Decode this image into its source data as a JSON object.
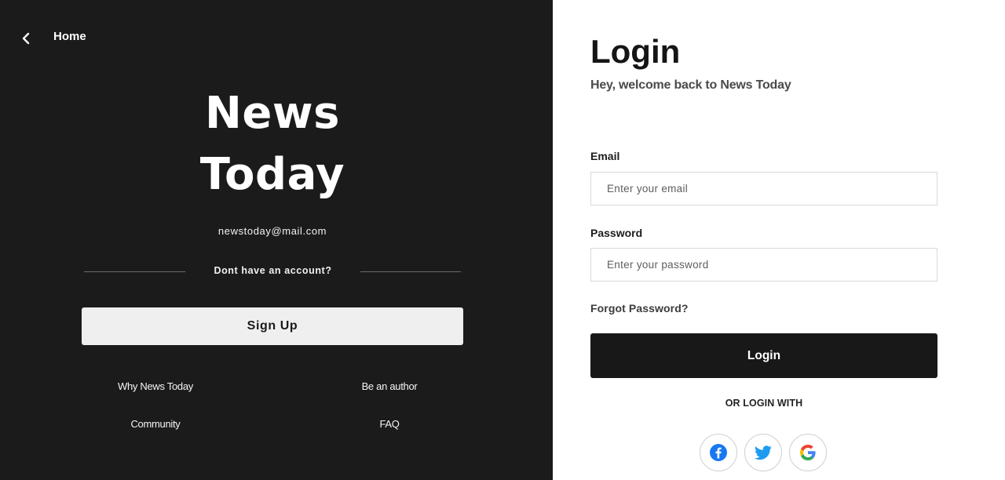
{
  "nav": {
    "back_icon": "chevron-left-icon",
    "home_label": "Home"
  },
  "brand": {
    "line1": "News",
    "line2": "Today",
    "email": "newstoday@mail.com"
  },
  "signup_section": {
    "divider_text": "Dont have an account?",
    "signup_label": "Sign Up"
  },
  "footer_links": [
    {
      "label": "Why News Today"
    },
    {
      "label": "Be an author"
    },
    {
      "label": "Community"
    },
    {
      "label": "FAQ"
    }
  ],
  "login": {
    "title": "Login",
    "subtitle": "Hey, welcome back to News Today",
    "email_label": "Email",
    "email_placeholder": "Enter your email",
    "email_value": "",
    "password_label": "Password",
    "password_placeholder": "Enter your password",
    "password_value": "",
    "forgot_label": "Forgot Password?",
    "submit_label": "Login",
    "social_divider": "OR LOGIN WITH",
    "social": [
      {
        "icon": "facebook-icon",
        "color": "#1877f2"
      },
      {
        "icon": "twitter-icon",
        "color": "#1d9bf0"
      },
      {
        "icon": "google-icon",
        "color": "#4285f4"
      }
    ]
  },
  "colors": {
    "left_bg": "#1c1b1b",
    "right_bg": "#ffffff",
    "primary_button": "#181818",
    "secondary_button": "#efefef"
  }
}
